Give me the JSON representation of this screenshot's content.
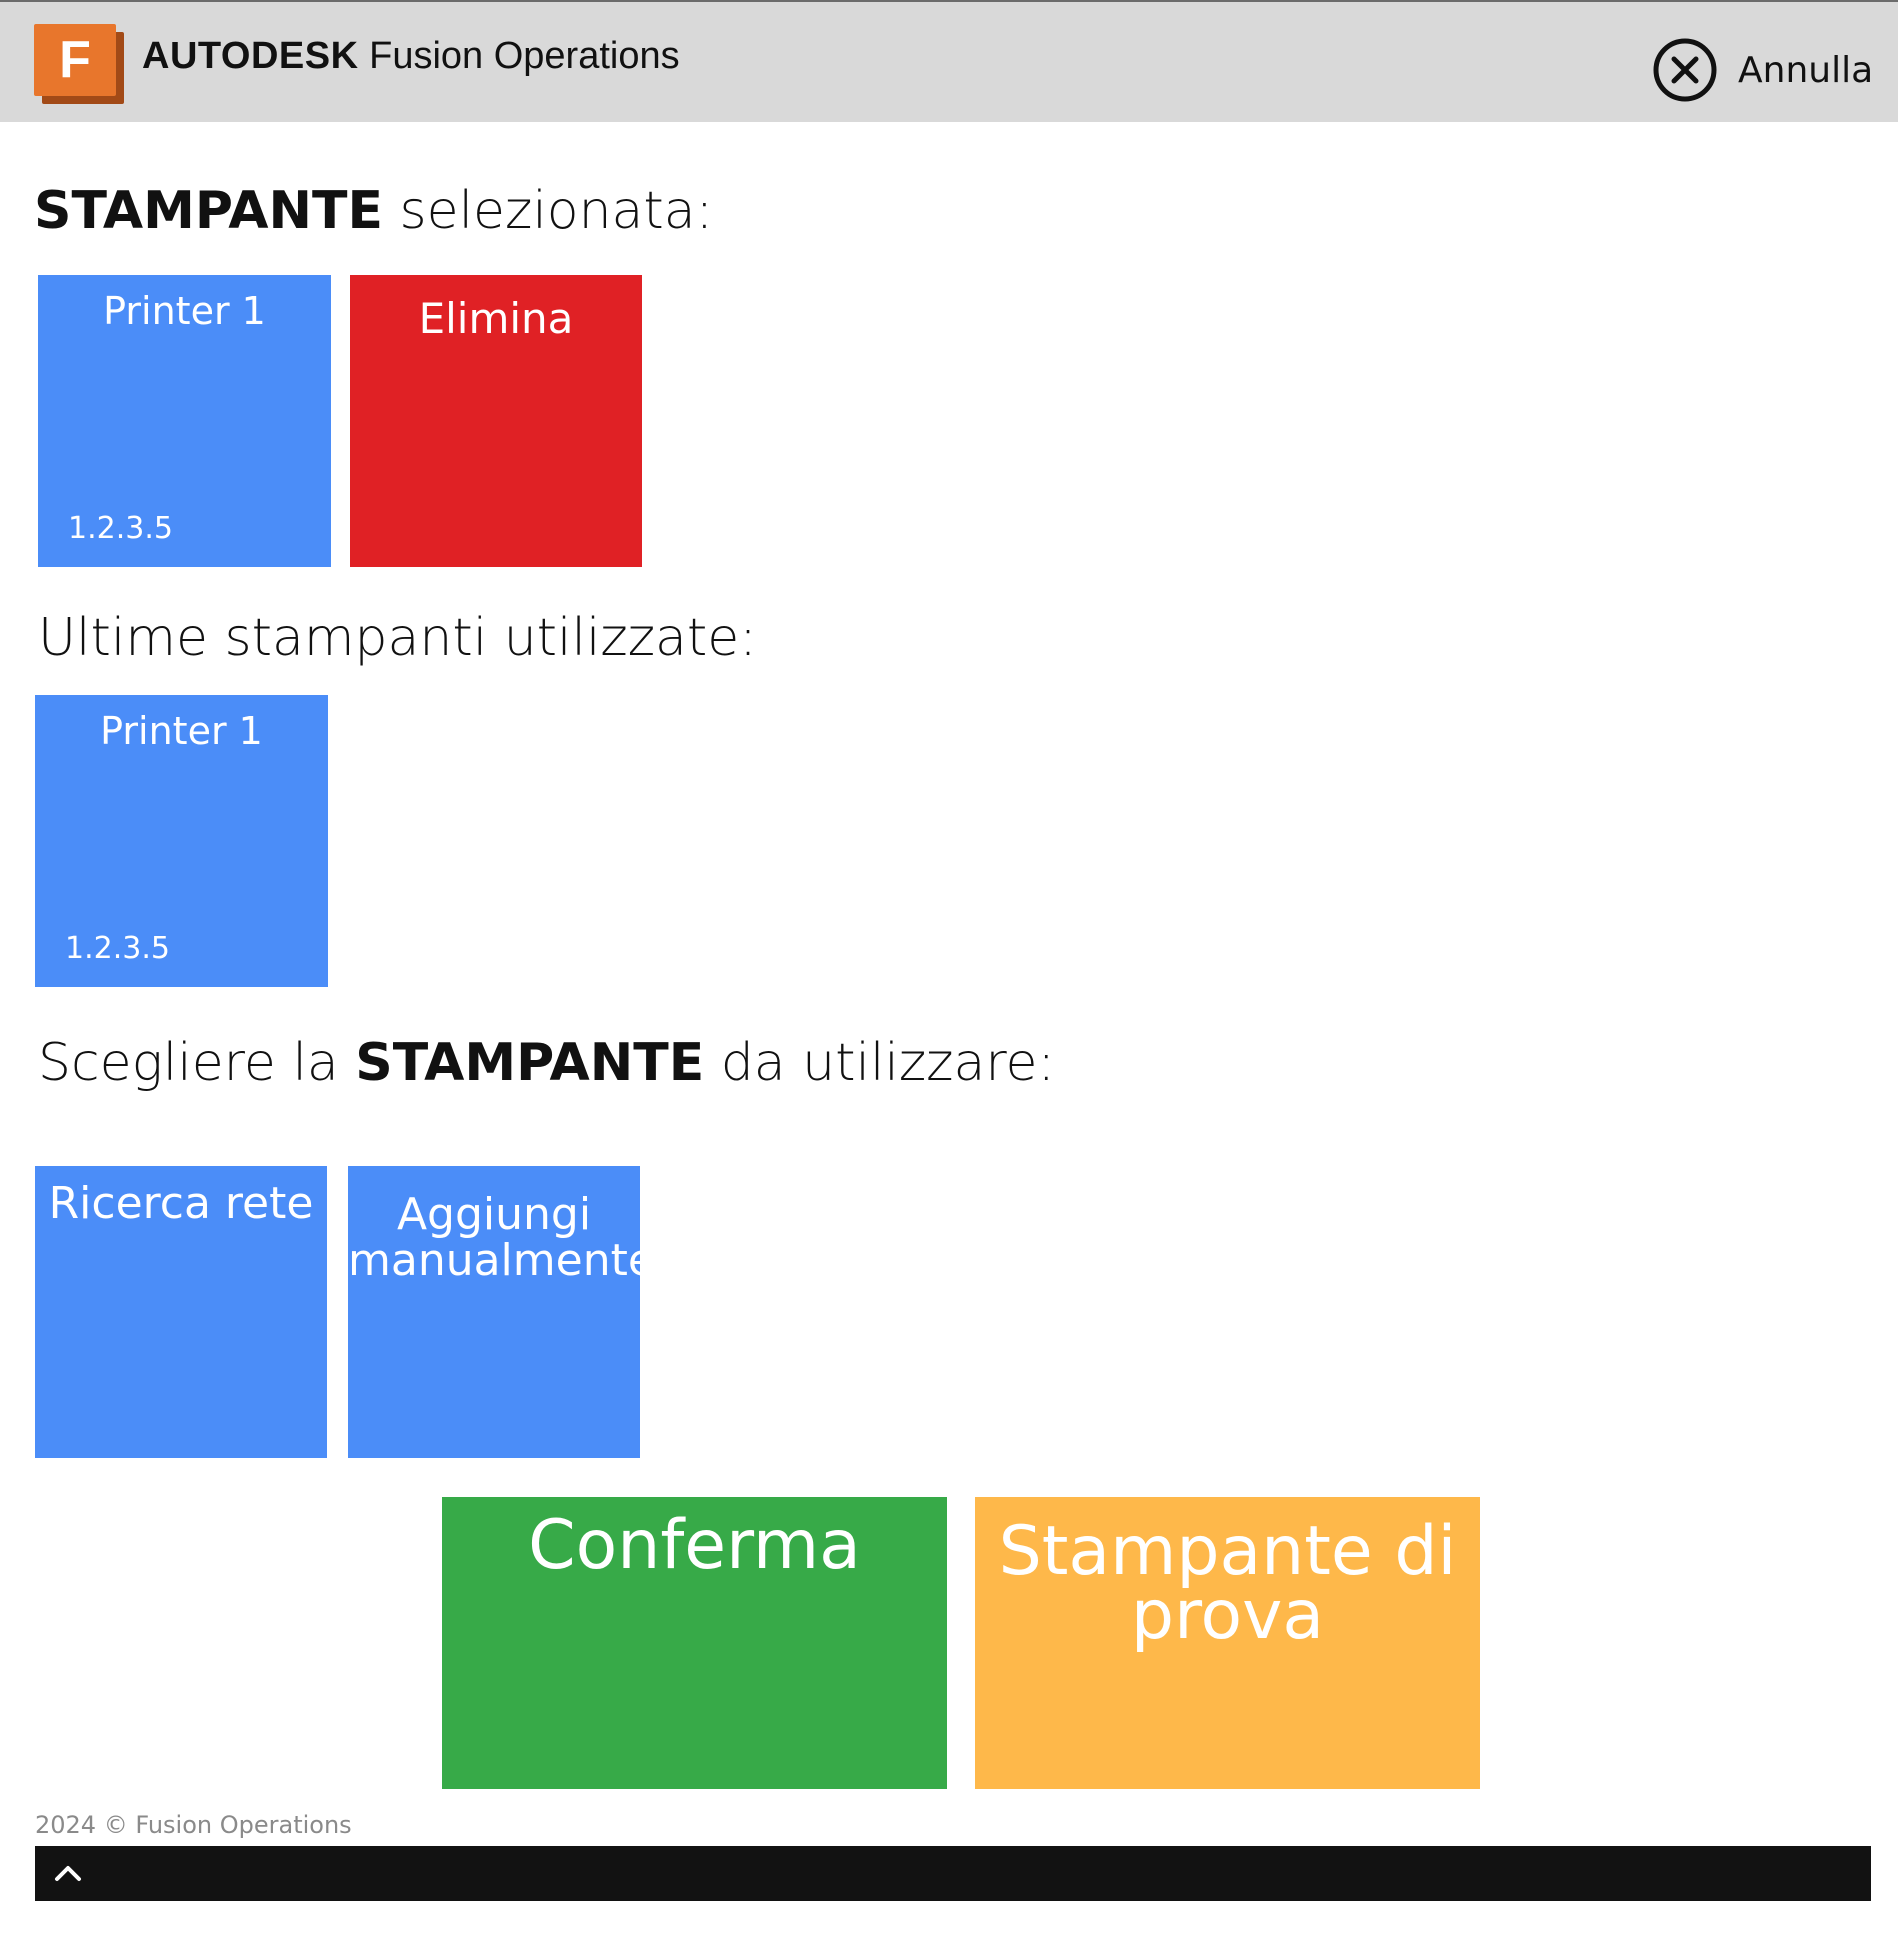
{
  "header": {
    "logo_letter": "F",
    "brand_strong": "AUTODESK",
    "brand_rest": " Fusion Operations",
    "cancel_label": "Annulla",
    "cancel_icon": "close-circle-icon"
  },
  "selected_section": {
    "heading_bold": "STAMPANTE",
    "heading_rest": " selezionata:",
    "printer": {
      "name": "Printer 1",
      "ip": "1.2.3.5"
    },
    "delete_label": "Elimina"
  },
  "recent_section": {
    "heading": "Ultime stampanti utilizzate:",
    "printers": [
      {
        "name": "Printer 1",
        "ip": "1.2.3.5"
      }
    ]
  },
  "choose_section": {
    "heading_pre": "Scegliere la ",
    "heading_bold": "STAMPANTE",
    "heading_post": " da utilizzare:",
    "search_label": "Ricerca rete",
    "add_line1": "Aggiungi",
    "add_line2": "manualmente"
  },
  "actions": {
    "confirm_label": "Conferma",
    "test_line1": "Stampante di",
    "test_line2": "prova"
  },
  "footer": {
    "copyright": "2024 © Fusion Operations",
    "toggle_icon": "chevron-up-icon"
  },
  "colors": {
    "blue": "#4b8df8",
    "red": "#e02125",
    "green": "#37aa48",
    "orange": "#feb84a",
    "header_bg": "#d9d9d9",
    "logo_orange": "#e8762c"
  }
}
